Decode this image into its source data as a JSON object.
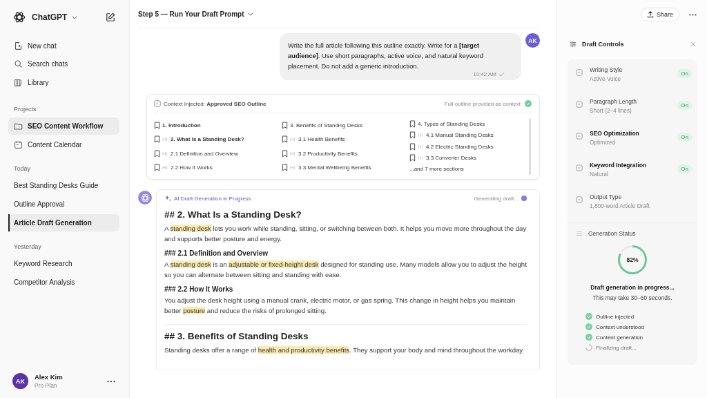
{
  "sidebar": {
    "app_name": "ChatGPT",
    "nav": [
      {
        "label": "New chat"
      },
      {
        "label": "Search chats"
      },
      {
        "label": "Library"
      }
    ],
    "sections": [
      {
        "title": "Projects",
        "kind": "projects",
        "items": [
          {
            "label": "SEO Content Workflow",
            "selected": true
          },
          {
            "label": "Content Calendar",
            "selected": false
          }
        ]
      },
      {
        "title": "Today",
        "items": [
          {
            "label": "Best Standing Desks Guide",
            "selected": false
          },
          {
            "label": "Outline Approval",
            "selected": false
          },
          {
            "label": "Article Draft Generation",
            "selected": true
          }
        ]
      },
      {
        "title": "Yesterday",
        "items": [
          {
            "label": "Keyword Research",
            "selected": false
          },
          {
            "label": "Competitor Analysis",
            "selected": false
          }
        ]
      }
    ],
    "user": {
      "initials": "AK",
      "name": "Alex Kim",
      "plan": "Pro Plan"
    }
  },
  "header": {
    "title": "Step 5 — Run Your Draft Prompt",
    "share": "Share"
  },
  "user_message": {
    "avatar": "AK",
    "text": "Write the full article following this outline exactly. Write for a **[target audience]**. Use short paragraphs, active voice, and natural keyword placement. Do not add a generic introduction.",
    "time": "10:42 AM"
  },
  "context": {
    "label": "Context Injected:",
    "title": "Approved SEO Outline",
    "note": "Full outline provided as context",
    "columns": [
      [
        {
          "text": "1. Introduction",
          "kind": "h2",
          "bold": true
        },
        {
          "text": "2. What Is a Standing Desk?",
          "kind": "h3",
          "bold": true
        },
        {
          "text": "2.1 Definition and Overview",
          "kind": "h3",
          "bold": false
        },
        {
          "text": "2.2 How It Works",
          "kind": "h3",
          "bold": false
        }
      ],
      [
        {
          "text": "3. Benefits of Standing Desks",
          "kind": "h2",
          "bold": false
        },
        {
          "text": "3.1 Health Benefits",
          "kind": "h3",
          "bold": false
        },
        {
          "text": "3.2 Productivity Benefits",
          "kind": "h3",
          "bold": false
        },
        {
          "text": "3.3 Mental Wellbeing Benefits",
          "kind": "h3",
          "bold": false
        }
      ],
      [
        {
          "text": "4. Types of Standing Desks",
          "kind": "h2",
          "bold": false
        },
        {
          "text": "4.1 Manual Standing Desks",
          "kind": "h3",
          "bold": false
        },
        {
          "text": "4.2 Electric Standing Desks",
          "kind": "h3",
          "bold": false
        },
        {
          "text": "3.3 Converter Desks",
          "kind": "h3",
          "bold": false
        },
        {
          "text": "...and 7 more sections",
          "kind": "more"
        }
      ]
    ]
  },
  "draft": {
    "label": "AI Draft Generation in Progress",
    "status": "Generating draft...",
    "blocks": [
      {
        "kind": "h2",
        "text": "## 2. What Is a Standing Desk?"
      },
      {
        "kind": "p",
        "segments": [
          {
            "text": "A ",
            "highlight": false
          },
          {
            "text": "standing desk",
            "highlight": true
          },
          {
            "text": " lets you work while standing, sitting, or switching between both. It helps you move more throughout the day and supports better posture and energy.",
            "highlight": false
          }
        ]
      },
      {
        "kind": "h3",
        "text": "### 2.1 Definition and Overview"
      },
      {
        "kind": "p",
        "segments": [
          {
            "text": "A ",
            "highlight": false
          },
          {
            "text": "standing desk",
            "highlight": true
          },
          {
            "text": " is an ",
            "highlight": false
          },
          {
            "text": "adjustable or fixed-height desk",
            "highlight": true
          },
          {
            "text": " designed for standing use. Many models allow you to adjust the height so you can alternate between sitting and standing with ease.",
            "highlight": false
          }
        ]
      },
      {
        "kind": "h3",
        "text": "### 2.2 How It Works"
      },
      {
        "kind": "p",
        "segments": [
          {
            "text": "You adjust the desk height using a manual crank, electric motor, or gas spring. This change in height helps you maintain better ",
            "highlight": false
          },
          {
            "text": "posture",
            "highlight": true
          },
          {
            "text": " and reduce the risks of prolonged sitting.",
            "highlight": false
          }
        ]
      },
      {
        "kind": "divider"
      },
      {
        "kind": "h2",
        "text": "## 3. Benefits of Standing Desks"
      },
      {
        "kind": "p",
        "segments": [
          {
            "text": "Standing desks offer a range of ",
            "highlight": false
          },
          {
            "text": "health and productivity benefits",
            "highlight": true
          },
          {
            "text": ". They support your body and mind throughout the workday.",
            "highlight": false
          }
        ]
      }
    ]
  },
  "controls": {
    "title": "Draft Controls",
    "items": [
      {
        "name": "Writing Style",
        "value": "Active Voice",
        "badge": "On",
        "emphasized": false
      },
      {
        "name": "Paragraph Length",
        "value": "Short (2–4 lines)",
        "badge": "On",
        "emphasized": false
      },
      {
        "name": "SEO Optimization",
        "value": "Optimized",
        "badge": "On",
        "emphasized": true
      },
      {
        "name": "Keyword Integration",
        "value": "Natural",
        "badge": "On",
        "emphasized": true
      },
      {
        "name": "Output Type",
        "value": "1,800-word Article Draft",
        "emphasized": false
      }
    ]
  },
  "status": {
    "title": "Generation Status",
    "percent": "82%",
    "headline": "Draft generation in progress...",
    "subtext": "This may take 30–60 seconds.",
    "steps": [
      {
        "label": "Outline injected",
        "done": true
      },
      {
        "label": "Context understood",
        "done": true
      },
      {
        "label": "Content generation",
        "done": true
      },
      {
        "label": "Finalizing draft...",
        "done": false
      }
    ]
  }
}
